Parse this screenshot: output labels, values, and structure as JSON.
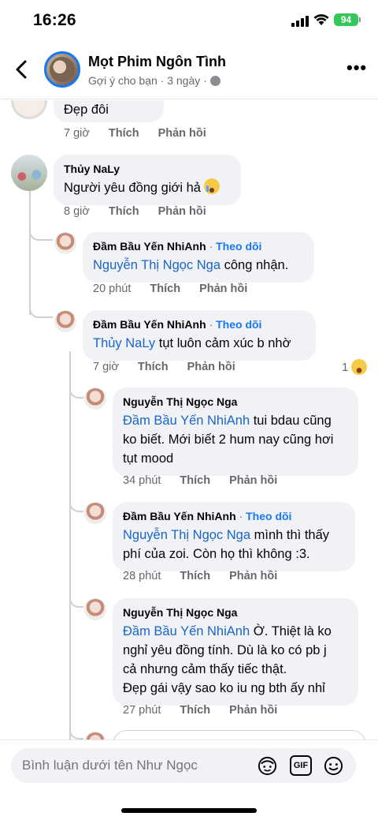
{
  "status_bar": {
    "time": "16:26",
    "battery": "94"
  },
  "header": {
    "page_name": "Mọt Phim Ngôn Tình",
    "subtitle": "Gợi ý cho bạn · 3 ngày ·"
  },
  "comments": [
    {
      "author": "",
      "text": "Đẹp đôi",
      "time": "7 giờ",
      "like": "Thích",
      "reply": "Phản hồi"
    },
    {
      "author": "Thủy NaLy",
      "text": "Người yêu đồng giới hả",
      "time": "8 giờ",
      "like": "Thích",
      "reply": "Phản hồi"
    },
    {
      "author": "Đầm Bầu Yến NhiAnh",
      "follow": "Theo dõi",
      "separator": "·",
      "mention": "Nguyễn Thị Ngọc Nga",
      "text": " công nhận.",
      "time": "20 phút",
      "like": "Thích",
      "reply": "Phản hồi"
    },
    {
      "author": "Đầm Bầu Yến NhiAnh",
      "follow": "Theo dõi",
      "separator": "·",
      "mention": "Thủy NaLy",
      "text": " tụt luôn cảm xúc b nhờ",
      "time": "7 giờ",
      "like": "Thích",
      "reply": "Phản hồi",
      "reaction_count": "1"
    },
    {
      "author": "Nguyễn Thị Ngọc Nga",
      "mention": "Đầm Bầu Yến NhiAnh",
      "text_line1": " tui bdau cũng",
      "text_line2": "ko biết. Mới biết 2 hum nay cũng hơi",
      "text_line3": "tụt mood",
      "time": "34 phút",
      "like": "Thích",
      "reply": "Phản hồi"
    },
    {
      "author": "Đầm Bầu Yến NhiAnh",
      "follow": "Theo dõi",
      "separator": "·",
      "mention": "Nguyễn Thị Ngọc Nga",
      "text_line1": " mình thì thấy",
      "text_line2": "phí của zoi. Còn họ thì không :3.",
      "time": "28 phút",
      "like": "Thích",
      "reply": "Phản hồi"
    },
    {
      "author": "Nguyễn Thị Ngọc Nga",
      "mention": "Đầm Bầu Yến NhiAnh",
      "text_line1": " Ờ. Thiệt là ko",
      "text_line2": "nghỉ yêu đồng tính. Dù là ko có pb j",
      "text_line3": "cả nhưng cảm thấy tiếc thật.",
      "text_line4": "Đẹp gái vậy sao ko iu ng bth ấy nhỉ",
      "time": "27 phút",
      "like": "Thích",
      "reply": "Phản hồi"
    }
  ],
  "composer": {
    "placeholder": "Bình luận dưới tên Như Ngọc",
    "gif_label": "GIF"
  },
  "colors": {
    "accent": "#1877f2",
    "bubble": "#f0f2f5",
    "meta": "#65676b"
  }
}
